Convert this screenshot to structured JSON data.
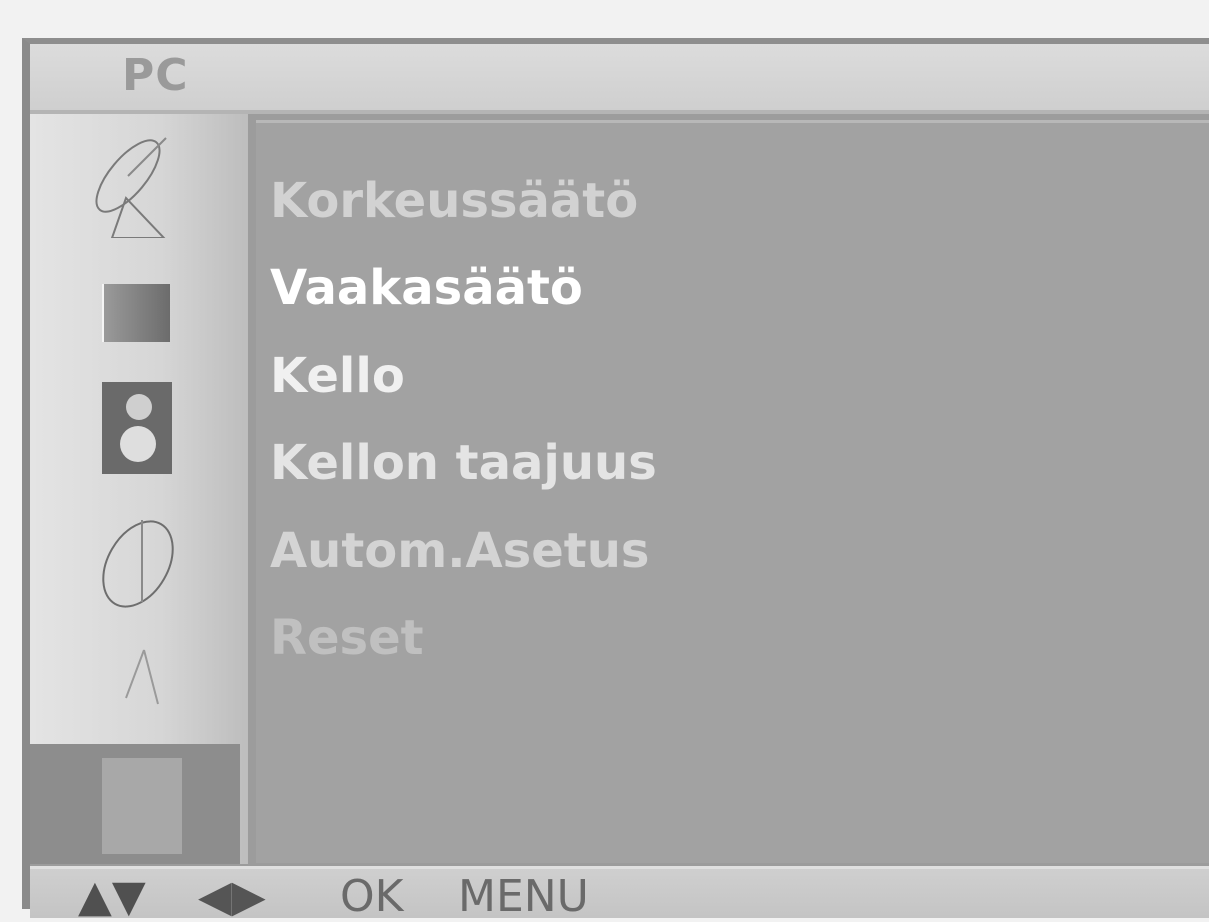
{
  "header": {
    "title": "PC"
  },
  "sidebar": {
    "icons": [
      "satellite-dish-icon",
      "picture-icon",
      "speaker-icon",
      "clock-icon",
      "tools-icon",
      "pc-icon"
    ]
  },
  "menu": {
    "items": [
      {
        "label": "Korkeussäätö",
        "color": "#d2d2d2"
      },
      {
        "label": "Vaakasäätö",
        "color": "#ffffff"
      },
      {
        "label": "Kello",
        "color": "#f0f0f0"
      },
      {
        "label": "Kellon taajuus",
        "color": "#e4e4e4"
      },
      {
        "label": "Autom.Asetus",
        "color": "#d4d4d4"
      },
      {
        "label": "Reset",
        "color": "#c0c0c0"
      }
    ]
  },
  "footer": {
    "up_down": "▲▼",
    "left_right": "◀▶",
    "ok_label": "OK",
    "menu_label": "MENU"
  }
}
